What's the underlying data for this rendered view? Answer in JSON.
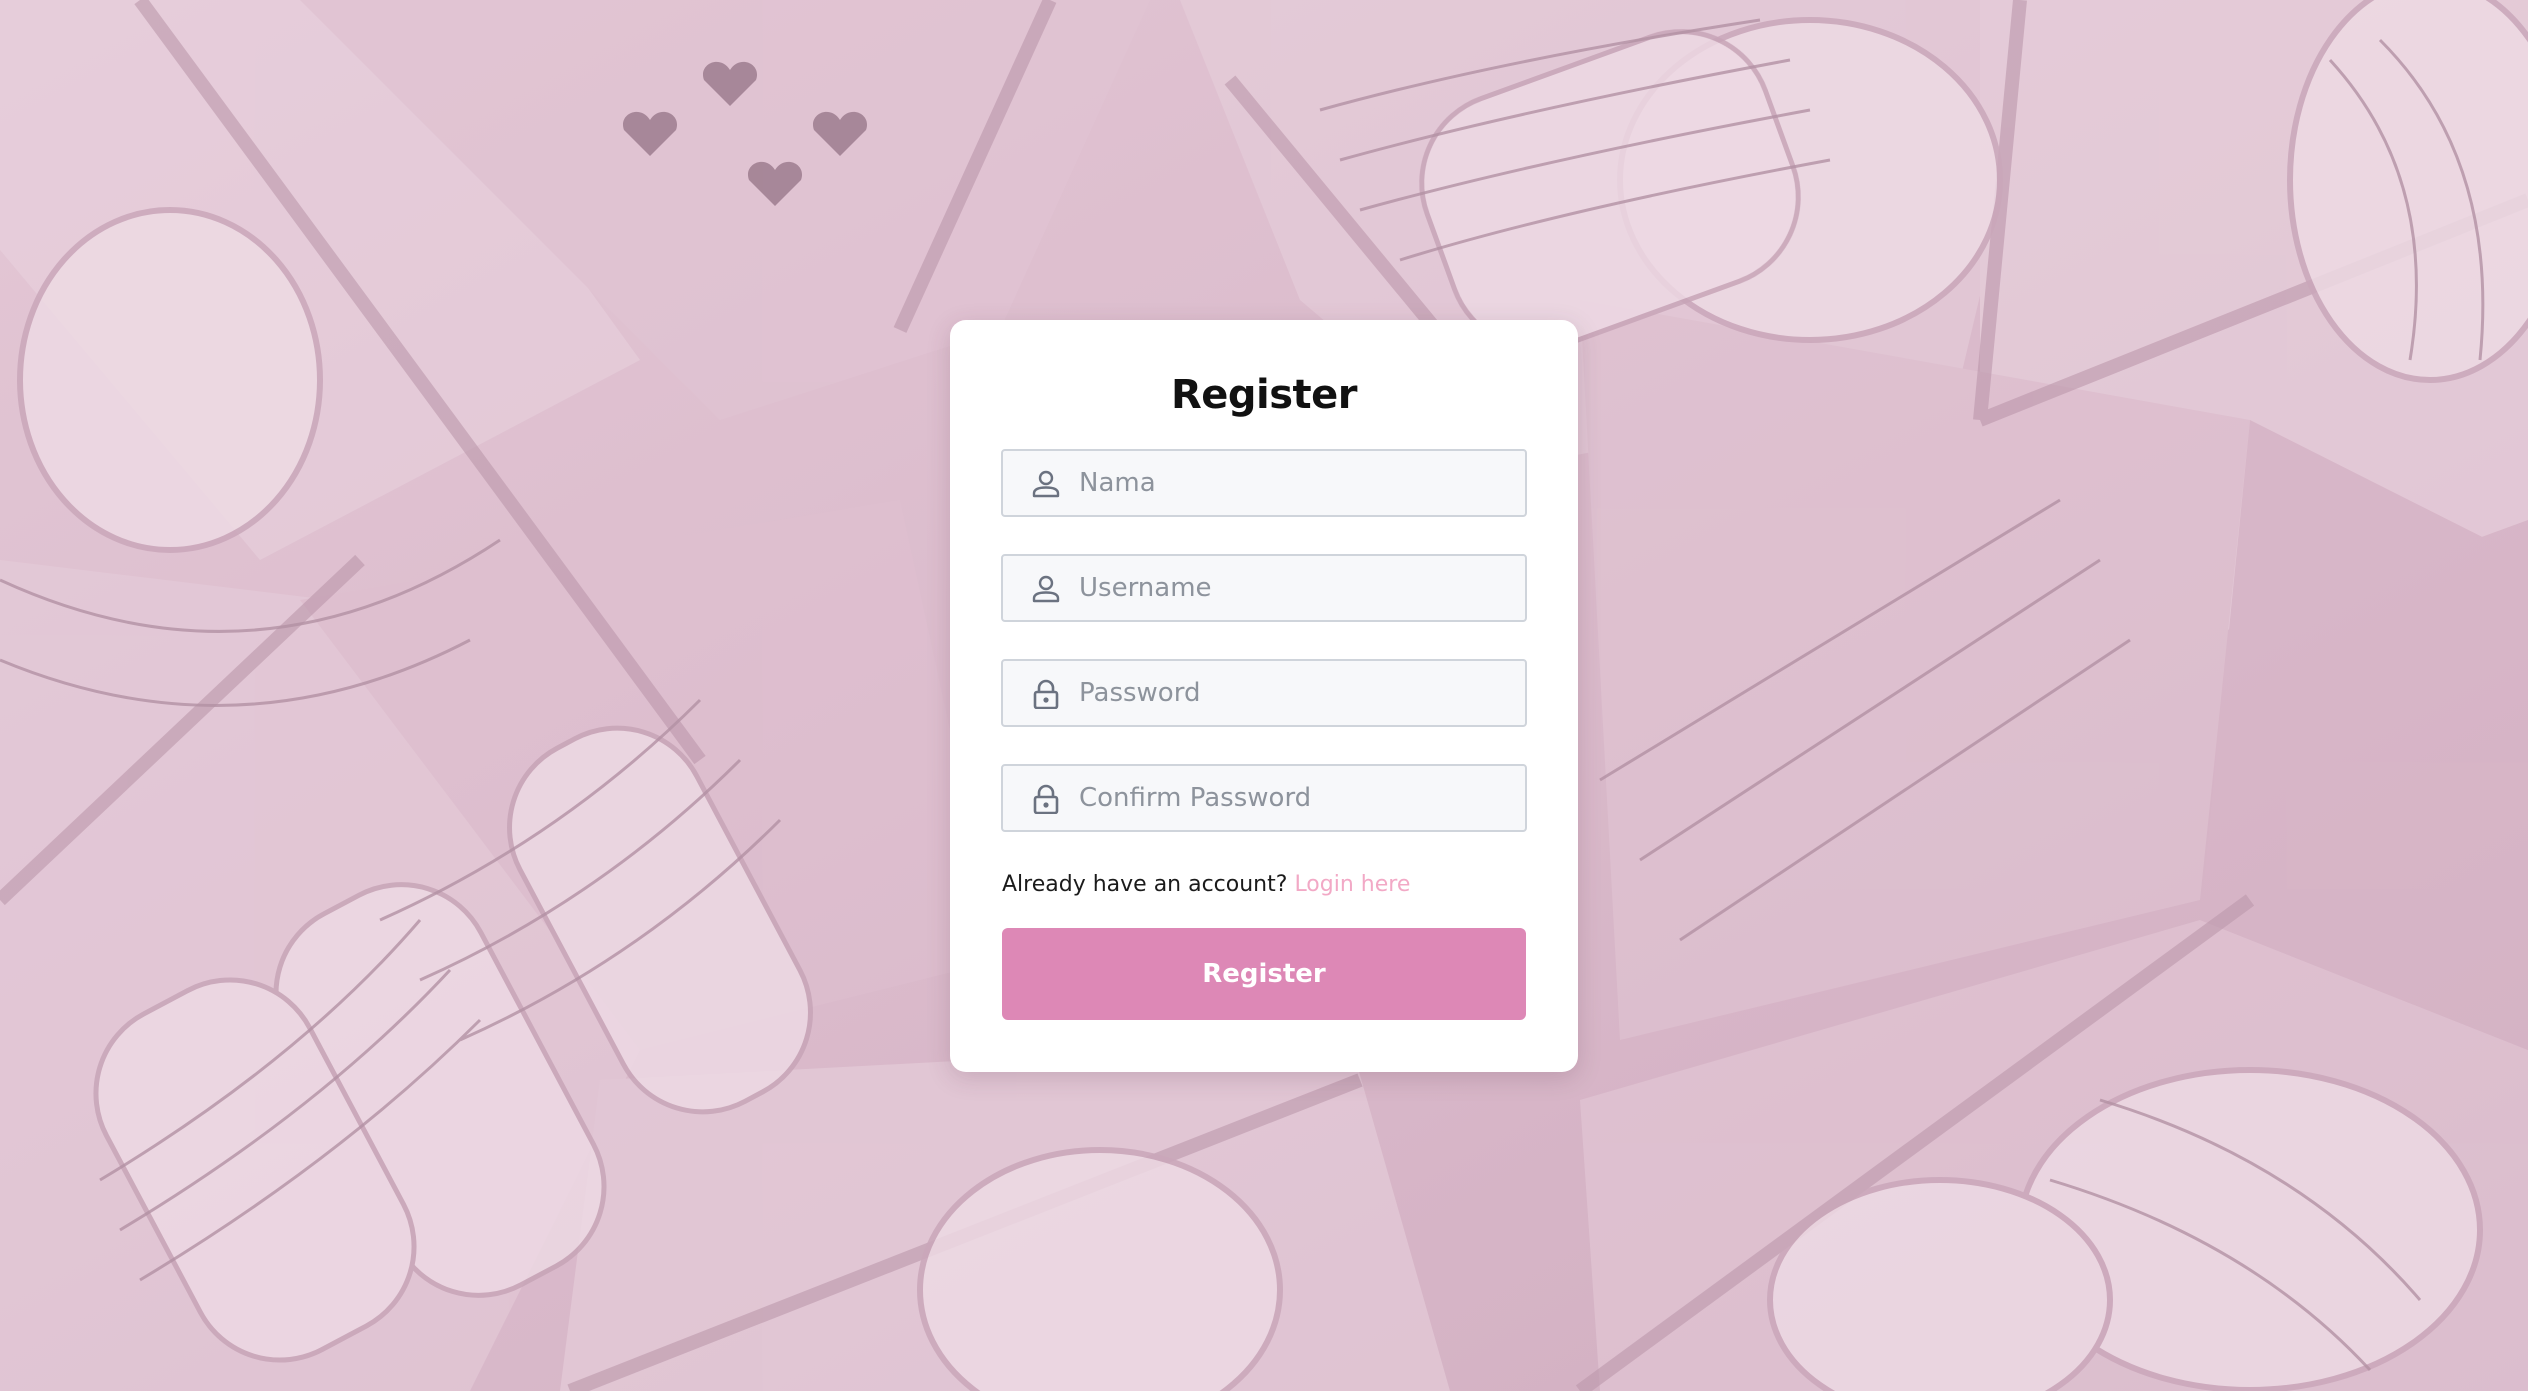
{
  "page": {
    "title": "Register"
  },
  "form": {
    "fields": [
      {
        "icon": "user-icon",
        "placeholder": "Nama",
        "type": "text",
        "value": ""
      },
      {
        "icon": "user-icon",
        "placeholder": "Username",
        "type": "text",
        "value": ""
      },
      {
        "icon": "lock-icon",
        "placeholder": "Password",
        "type": "password",
        "value": ""
      },
      {
        "icon": "lock-icon",
        "placeholder": "Confirm Password",
        "type": "password",
        "value": ""
      }
    ],
    "account_prompt": "Already have an account?",
    "login_link": "Login here",
    "submit_label": "Register"
  },
  "colors": {
    "accent": "#dd88b6",
    "link": "#f2a9c6",
    "background_tint": "#d9bccb"
  }
}
